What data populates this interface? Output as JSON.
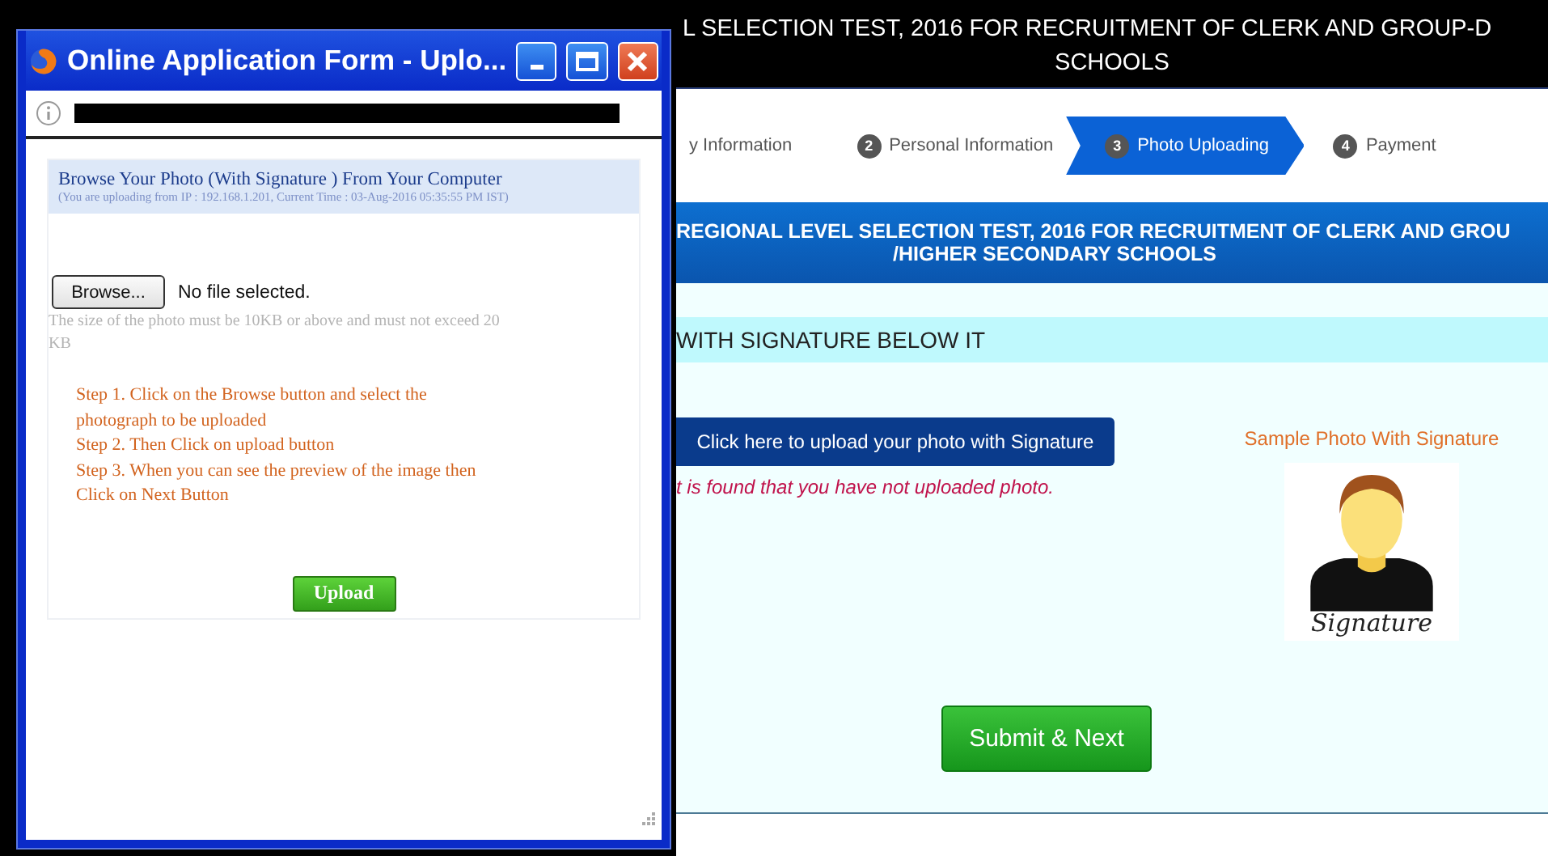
{
  "page": {
    "header": {
      "lines": [
        "L SELECTION TEST, 2016 FOR RECRUITMENT OF CLERK AND GROUP-D",
        "SCHOOLS"
      ]
    },
    "steps": [
      {
        "label": "y Information",
        "selected": false
      },
      {
        "number": "2",
        "label": "Personal Information",
        "selected": false
      },
      {
        "number": "3",
        "label": "Photo Uploading",
        "selected": true
      },
      {
        "number": "4",
        "label": "Payment",
        "selected": false
      }
    ],
    "banner": {
      "lines": [
        "REGIONAL LEVEL SELECTION TEST, 2016 FOR RECRUITMENT OF CLERK AND GROU",
        "/HIGHER SECONDARY SCHOOLS"
      ]
    },
    "section_heading": "WITH SIGNATURE BELOW IT",
    "upload_button": "Click here to upload your photo with Signature",
    "error_message": "t is found that you have not uploaded photo.",
    "sample": {
      "label": "Sample Photo With Signature",
      "signature": "Signature"
    },
    "submit_button": "Submit & Next"
  },
  "popup": {
    "window": {
      "title": "Online Application Form - Uplo..."
    },
    "panel": {
      "title": "Browse Your Photo (With Signature ) From Your Computer",
      "subtitle": "(You are uploading from IP : 192.168.1.201, Current Time : 03-Aug-2016 05:35:55 PM IST)"
    },
    "file_input": {
      "button": "Browse...",
      "status": "No file selected."
    },
    "size_note": "The size of the photo must be 10KB or above and must not exceed 20 KB",
    "instructions": [
      "Step 1. Click on the Browse button and select the photograph to be uploaded",
      "Step 2. Then Click on upload button",
      "Step 3. When you can see the preview of the image then Click on Next Button"
    ],
    "upload_button": "Upload"
  }
}
